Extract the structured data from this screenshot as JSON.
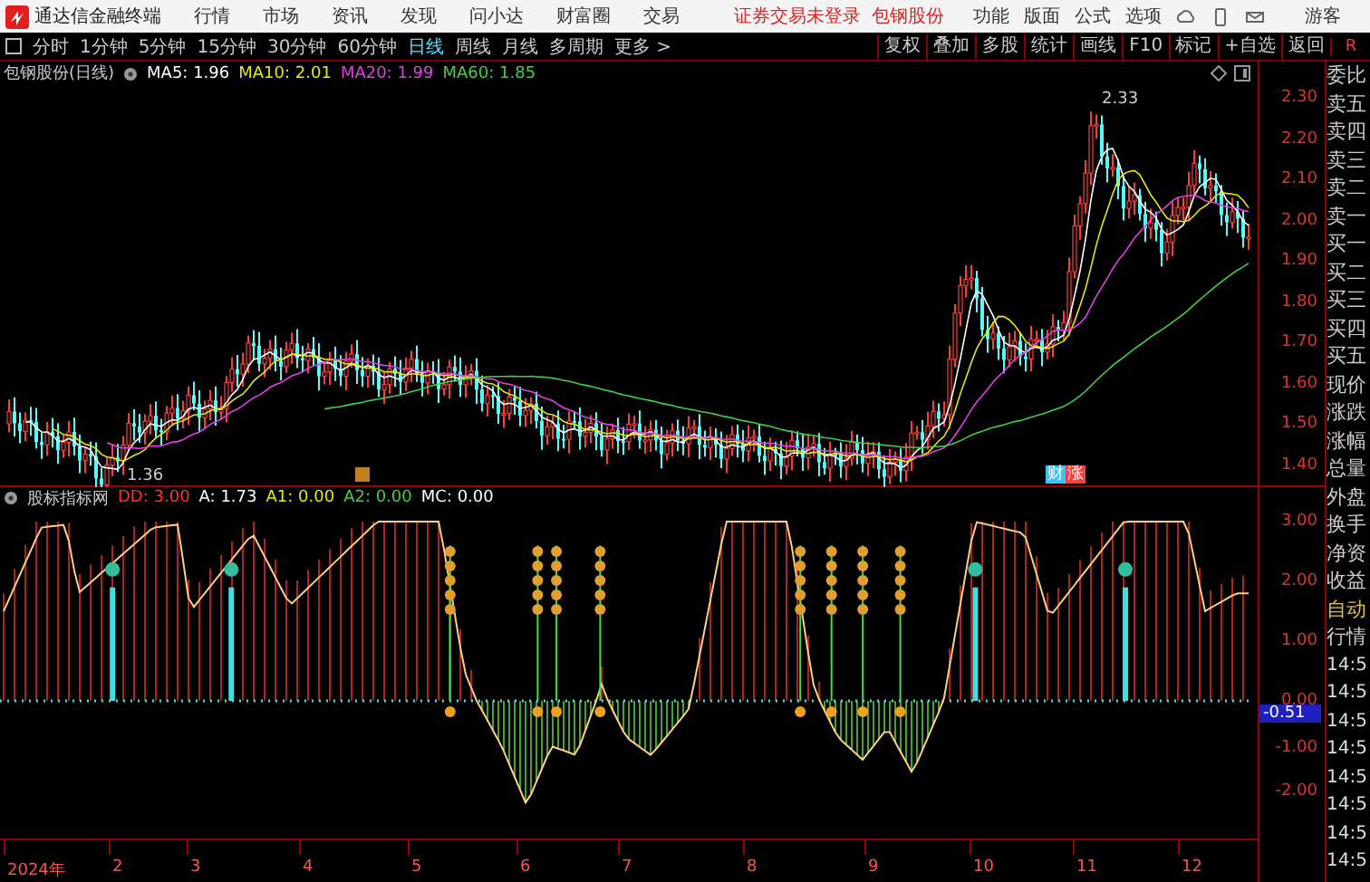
{
  "app": {
    "title": "通达信金融终端",
    "menu": [
      "行情",
      "市场",
      "资讯",
      "发现",
      "问小达",
      "财富圈",
      "交易"
    ],
    "notice": "证券交易未登录",
    "stock_link": "包钢股份",
    "tools": [
      "功能",
      "版面",
      "公式",
      "选项"
    ],
    "user": "游客"
  },
  "periods": [
    {
      "label": "分时",
      "selected": false
    },
    {
      "label": "1分钟",
      "selected": false
    },
    {
      "label": "5分钟",
      "selected": false
    },
    {
      "label": "15分钟",
      "selected": false
    },
    {
      "label": "30分钟",
      "selected": false
    },
    {
      "label": "60分钟",
      "selected": false
    },
    {
      "label": "日线",
      "selected": true
    },
    {
      "label": "周线",
      "selected": false
    },
    {
      "label": "月线",
      "selected": false
    },
    {
      "label": "多周期",
      "selected": false
    },
    {
      "label": "更多 >",
      "selected": false
    }
  ],
  "actions": [
    "复权",
    "叠加",
    "多股",
    "统计",
    "画线",
    "F10",
    "标记",
    "+自选",
    "返回"
  ],
  "corner": "R",
  "price_chart": {
    "title": "包钢股份(日线)",
    "ma": [
      {
        "label": "MA5: 1.96",
        "color": "#ffffff"
      },
      {
        "label": "MA10: 2.01",
        "color": "#e8e800"
      },
      {
        "label": "MA20: 1.99",
        "color": "#e040e0"
      },
      {
        "label": "MA60: 1.85",
        "color": "#40d040"
      }
    ],
    "axis": [
      "2.30",
      "2.20",
      "2.10",
      "2.00",
      "1.90",
      "1.80",
      "1.70",
      "1.60",
      "1.50",
      "1.40"
    ],
    "high_label": "2.33",
    "low_label": "1.36",
    "event_marks": [
      {
        "label": "财",
        "color": "#40c0ff"
      },
      {
        "label": "涨",
        "color": "#ff4040"
      }
    ]
  },
  "indicator": {
    "title": "股标指标网",
    "values": [
      {
        "label": "DD: 3.00",
        "color": "#ff3030"
      },
      {
        "label": "A: 1.73",
        "color": "#ffffff"
      },
      {
        "label": "A1: 0.00",
        "color": "#e8e800"
      },
      {
        "label": "A2: 0.00",
        "color": "#40d040"
      },
      {
        "label": "MC: 0.00",
        "color": "#ffffff"
      }
    ],
    "axis": [
      "3.00",
      "2.00",
      "1.00",
      "0.00",
      "-1.00",
      "-2.00"
    ],
    "current": "-0.51"
  },
  "dates": [
    "2024年",
    "2",
    "3",
    "4",
    "5",
    "6",
    "7",
    "8",
    "9",
    "10",
    "11",
    "12"
  ],
  "quote_panel": {
    "labels": [
      "委比",
      "卖五",
      "卖四",
      "卖三",
      "卖二",
      "卖一",
      "买一",
      "买二",
      "买三",
      "买四",
      "买五",
      "现价",
      "涨跌",
      "涨幅",
      "总量",
      "外盘",
      "换手",
      "净资",
      "收益",
      "自动",
      "行情"
    ],
    "times": [
      "14:5",
      "14:5",
      "14:5",
      "14:5",
      "14:5",
      "14:5",
      "14:5",
      "14:5"
    ]
  }
}
